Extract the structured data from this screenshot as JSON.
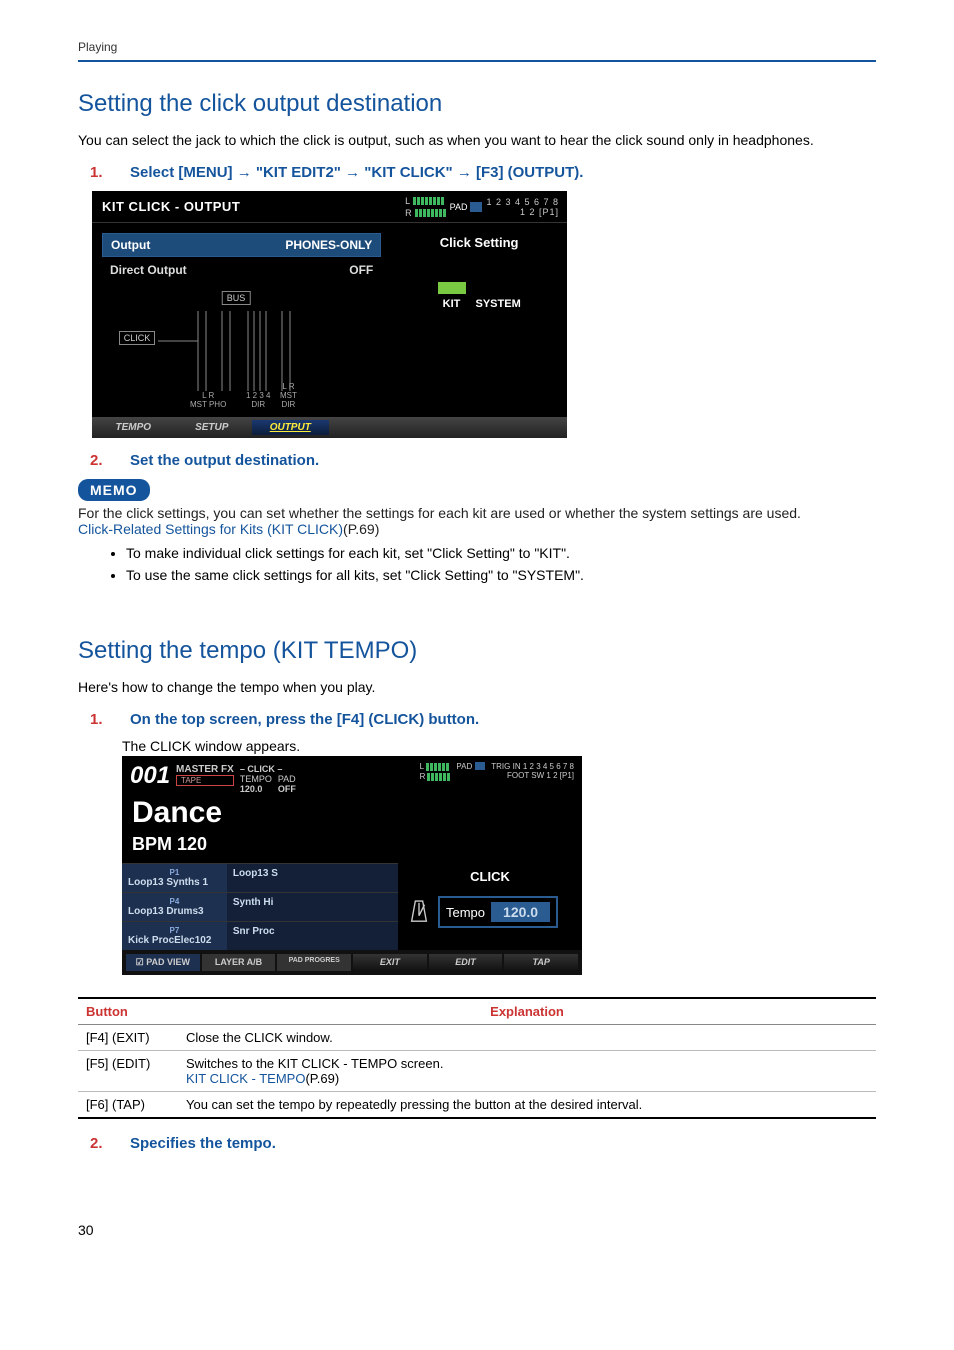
{
  "header": {
    "section": "Playing"
  },
  "sectionA": {
    "title": "Setting the click output destination",
    "intro": "You can select the jack to which the click is output, such as when you want to hear the click sound only in headphones.",
    "step1_num": "1.",
    "step1_txt_a": "Select [MENU] ",
    "step1_txt_b": " \"KIT EDIT2\" ",
    "step1_txt_c": " \"KIT CLICK\" ",
    "step1_txt_d": " [F3] (OUTPUT).",
    "step2_num": "2.",
    "step2_txt": "Set the output destination."
  },
  "screenshot1": {
    "title": "KIT CLICK - OUTPUT",
    "meter_L": "L",
    "meter_R": "R",
    "pad": "PAD",
    "nums": "1 2 3 4 5 6 7 8",
    "p1": "1 2 [P1]",
    "rowA_label": "Output",
    "rowA_value": "PHONES-ONLY",
    "rowB_label": "Direct Output",
    "rowB_value": "OFF",
    "bus": "BUS",
    "click": "CLICK",
    "lr1": "L R",
    "mstpho": "MST PHO",
    "d1234": "1 2 3 4",
    "dir": "DIR",
    "lr2": "L R",
    "mst": "MST",
    "dir2": "DIR",
    "right_title": "Click Setting",
    "kit": "KIT",
    "system": "SYSTEM",
    "foot1": "TEMPO",
    "foot2": "SETUP",
    "foot3": "OUTPUT"
  },
  "memo": {
    "badge": "MEMO",
    "body": "For the click settings, you can set whether the settings for each kit are used or whether the system settings are used.",
    "link": "Click-Related Settings for Kits (KIT CLICK)",
    "link_suffix": "(P.69)",
    "bullet1": "To make individual click settings for each kit, set \"Click Setting\" to \"KIT\".",
    "bullet2": "To use the same click settings for all kits, set \"Click Setting\" to \"SYSTEM\"."
  },
  "sectionB": {
    "title": "Setting the tempo (KIT TEMPO)",
    "intro": "Here's how to change the tempo when you play.",
    "step1_num": "1.",
    "step1_txt": "On the top screen, press the [F4] (CLICK) button.",
    "caption": "The CLICK window appears."
  },
  "screenshot2": {
    "kitno": "001",
    "masterfx": "MASTER FX",
    "tape": "TAPE",
    "click_hdr": "– CLICK –",
    "tempo_lbl": "TEMPO",
    "tempo_v": "120.0",
    "pad_hdr": "PAD",
    "pad_off": "OFF",
    "L": "L",
    "R": "R",
    "pad": "PAD",
    "trigin": "TRIG IN",
    "nums": "1 2 3 4 5 6 7 8",
    "footsw": "FOOT SW",
    "p1": "1 2 [P1]",
    "kitname": "Dance",
    "bpm": "BPM 120",
    "p1l": "P1",
    "r1l": "Loop13 Synths 1",
    "r1r": "Loop13 S",
    "p4l": "P4",
    "r2l": "Loop13 Drums3",
    "r2r": "Synth Hi",
    "p7l": "P7",
    "r3l": "Kick ProcElec102",
    "r3r": "Snr Proc",
    "click_title": "CLICK",
    "tempo_word": "Tempo",
    "tempo_val": "120.0",
    "f_padview": "☑ PAD VIEW",
    "f_layer": "LAYER A/B",
    "f_padprog": "PAD PROGRES",
    "f_exit": "EXIT",
    "f_edit": "EDIT",
    "f_tap": "TAP"
  },
  "table": {
    "h1": "Button",
    "h2": "Explanation",
    "rows": [
      {
        "b": "[F4] (EXIT)",
        "e": "Close the CLICK window."
      },
      {
        "b": "[F5] (EDIT)",
        "e_a": "Switches to the KIT CLICK - TEMPO screen.",
        "link": "KIT CLICK - TEMPO",
        "link_suf": "(P.69)"
      },
      {
        "b": "[F6] (TAP)",
        "e": "You can set the tempo by repeatedly pressing the button at the desired interval."
      }
    ]
  },
  "sectionB_step2": {
    "num": "2.",
    "txt": "Specifies the tempo."
  },
  "page_number": "30",
  "arrow": "→"
}
